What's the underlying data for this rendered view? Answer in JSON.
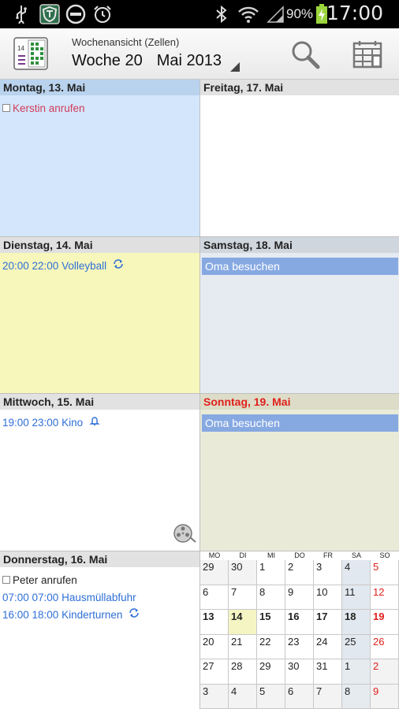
{
  "status_bar": {
    "battery_percent": "90%",
    "time": "17:00",
    "icons": [
      "usb-icon",
      "shield-app-icon",
      "do-not-disturb-icon",
      "alarm-icon",
      "bluetooth-icon",
      "wifi-icon",
      "signal-icon",
      "battery-charging-icon"
    ]
  },
  "action_bar": {
    "subtitle": "Wochenansicht (Zellen)",
    "week_label": "Woche 20",
    "month_label": "Mai 2013",
    "app_icon_day": "14",
    "search_icon": "search-icon",
    "calendar_view_icon": "calendar-view-icon"
  },
  "days": [
    {
      "key": "mon",
      "title": "Montag, 13. Mai",
      "events": [
        {
          "type": "task",
          "text": "Kerstin anrufen"
        }
      ]
    },
    {
      "key": "tue",
      "title": "Dienstag, 14. Mai",
      "events": [
        {
          "type": "timed",
          "text": "20:00 22:00 Volleyball",
          "icon": "repeat-icon"
        }
      ]
    },
    {
      "key": "wed",
      "title": "Mittwoch, 15. Mai",
      "events": [
        {
          "type": "timed",
          "text": "19:00 23:00 Kino",
          "icon": "bell-icon"
        }
      ]
    },
    {
      "key": "thu",
      "title": "Donnerstag, 16. Mai",
      "events": [
        {
          "type": "task",
          "text": "Peter anrufen"
        },
        {
          "type": "timed",
          "text": "07:00 07:00 Hausmüllabfuhr"
        },
        {
          "type": "timed",
          "text": "16:00 18:00 Kinderturnen",
          "icon": "repeat-icon"
        }
      ]
    },
    {
      "key": "fri",
      "title": "Freitag, 17. Mai",
      "events": []
    },
    {
      "key": "sat",
      "title": "Samstag, 18. Mai",
      "events": [
        {
          "type": "allday",
          "text": "Oma besuchen"
        }
      ]
    },
    {
      "key": "sun",
      "title": "Sonntag, 19. Mai",
      "events": [
        {
          "type": "allday",
          "text": "Oma besuchen"
        }
      ]
    }
  ],
  "colors": {
    "mon_bg": "#d3e6fb",
    "mon_head": "#b9d3ee",
    "tue_bg": "#f7f7bc",
    "wed_bg": "#ffffff",
    "thu_bg": "#ffffff",
    "fri_bg": "#ffffff",
    "sat_bg": "#e6ebf1",
    "sun_bg": "#e9ead8",
    "sun_head_text": "#e0201c",
    "event_blue": "#2f6fd6",
    "task_red": "#d23c5a",
    "allday_bar": "#87a9e2"
  },
  "mini_calendar": {
    "weekdays": [
      "MO",
      "DI",
      "MI",
      "DO",
      "FR",
      "SA",
      "SO"
    ],
    "weeks": [
      [
        {
          "d": "29",
          "cur": false
        },
        {
          "d": "30",
          "cur": false
        },
        {
          "d": "1",
          "cur": true
        },
        {
          "d": "2",
          "cur": true
        },
        {
          "d": "3",
          "cur": true
        },
        {
          "d": "4",
          "cur": true
        },
        {
          "d": "5",
          "cur": true
        }
      ],
      [
        {
          "d": "6",
          "cur": true
        },
        {
          "d": "7",
          "cur": true
        },
        {
          "d": "8",
          "cur": true
        },
        {
          "d": "9",
          "cur": true
        },
        {
          "d": "10",
          "cur": true
        },
        {
          "d": "11",
          "cur": true
        },
        {
          "d": "12",
          "cur": true
        }
      ],
      [
        {
          "d": "13",
          "cur": true,
          "bold": true
        },
        {
          "d": "14",
          "cur": true,
          "bold": true,
          "today": true
        },
        {
          "d": "15",
          "cur": true,
          "bold": true
        },
        {
          "d": "16",
          "cur": true,
          "bold": true
        },
        {
          "d": "17",
          "cur": true,
          "bold": true
        },
        {
          "d": "18",
          "cur": true,
          "bold": true
        },
        {
          "d": "19",
          "cur": true,
          "bold": true
        }
      ],
      [
        {
          "d": "20",
          "cur": true
        },
        {
          "d": "21",
          "cur": true
        },
        {
          "d": "22",
          "cur": true
        },
        {
          "d": "23",
          "cur": true
        },
        {
          "d": "24",
          "cur": true
        },
        {
          "d": "25",
          "cur": true
        },
        {
          "d": "26",
          "cur": true
        }
      ],
      [
        {
          "d": "27",
          "cur": true
        },
        {
          "d": "28",
          "cur": true
        },
        {
          "d": "29",
          "cur": true
        },
        {
          "d": "30",
          "cur": true
        },
        {
          "d": "31",
          "cur": true
        },
        {
          "d": "1",
          "cur": false
        },
        {
          "d": "2",
          "cur": false
        }
      ],
      [
        {
          "d": "3",
          "cur": false
        },
        {
          "d": "4",
          "cur": false
        },
        {
          "d": "5",
          "cur": false
        },
        {
          "d": "6",
          "cur": false
        },
        {
          "d": "7",
          "cur": false
        },
        {
          "d": "8",
          "cur": false
        },
        {
          "d": "9",
          "cur": false
        }
      ]
    ]
  }
}
